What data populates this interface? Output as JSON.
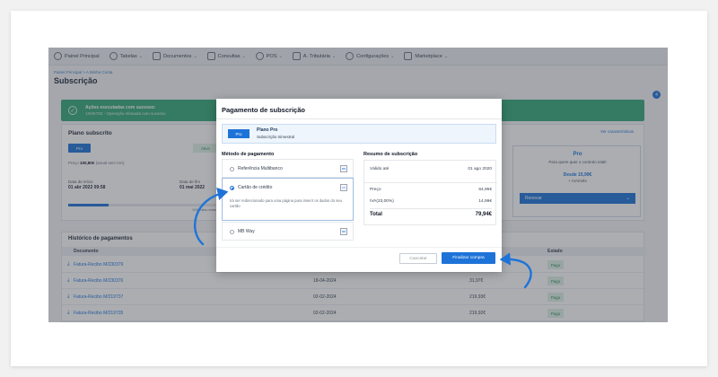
{
  "nav": {
    "items": [
      {
        "label": "Painel Principal",
        "icon": "dashboard-icon",
        "chevron": false
      },
      {
        "label": "Tabelas",
        "icon": "users-icon",
        "chevron": true
      },
      {
        "label": "Documentos",
        "icon": "document-icon",
        "chevron": true
      },
      {
        "label": "Consultas",
        "icon": "chart-icon",
        "chevron": true
      },
      {
        "label": "POS",
        "icon": "gear-icon",
        "chevron": true
      },
      {
        "label": "A. Tributária",
        "icon": "tax-icon",
        "chevron": true
      },
      {
        "label": "Configurações",
        "icon": "settings-icon",
        "chevron": true
      },
      {
        "label": "Marketplace",
        "icon": "grid-icon",
        "chevron": true
      }
    ]
  },
  "breadcrumb": "Painel Principal  >  A Minha Conta",
  "page_title": "Subscrição",
  "side_marker": "4",
  "success": {
    "title": "Ações executadas com sucesso:",
    "message": "1XNKT02 - Operação efetuada com sucesso"
  },
  "plan": {
    "title": "Plano subscrito",
    "plan_label": "Pro",
    "status": "Ativo",
    "price_label": "Preço",
    "price": "100,80€",
    "price_note": "(anual sem IVA)",
    "start_label": "Data de início",
    "start_value": "01 abr 2022 09:58",
    "end_label": "Data de fim",
    "end_value": "01 mai 2022",
    "progress": 0.25,
    "days_left": "1045 dias restantes",
    "compare_link": "Ver características",
    "offer": {
      "name": "Pro",
      "description": "Para quem quer o controlo total!",
      "price": "Desde 15,99€",
      "vat": "+ IVA/mês",
      "renew_button": "Renovar"
    }
  },
  "history": {
    "title": "Histórico de pagamentos",
    "columns": [
      "Documento",
      "Estado"
    ],
    "rows": [
      {
        "doc": "Fatura-Recibo M/230379",
        "date": "",
        "amount": "",
        "status": "Pago"
      },
      {
        "doc": "Fatura-Recibo M/230376",
        "date": "18-04-2024",
        "amount": "31,97€",
        "status": "Pago"
      },
      {
        "doc": "Fatura-Recibo M/219737",
        "date": "02-02-2024",
        "amount": "219,93€",
        "status": "Pago"
      },
      {
        "doc": "Fatura-Recibo M/219735",
        "date": "02-02-2024",
        "amount": "219,92€",
        "status": "Pago"
      }
    ]
  },
  "modal": {
    "title": "Pagamento de subscrição",
    "plan_pill": "Pro",
    "plan_name": "Plano Pro",
    "plan_sub": "Subscrição trimestral",
    "methods_title": "Método de pagamento",
    "methods": [
      {
        "label": "Referência Multibanco",
        "logo": "MB",
        "selected": false
      },
      {
        "label": "Cartão de crédito",
        "logo": "CC",
        "selected": true,
        "note": "Irá ser redirecionado para uma página para inserir os dados do seu cartão"
      },
      {
        "label": "MB Way",
        "logo": "MB",
        "selected": false
      }
    ],
    "summary_title": "Resumo de subscrição",
    "valid_label": "Válido até",
    "valid_value": "01 ago 2020",
    "price_label": "Preço",
    "price_value": "64,95€",
    "vat_label": "IVA(23,00%)",
    "vat_value": "14,99€",
    "total_label": "Total",
    "total_value": "79,94€",
    "cancel_button": "Cancelar",
    "finish_button": "Finalizar compra"
  },
  "colors": {
    "primary": "#1e73d8",
    "success": "#35a877",
    "annotation": "#1e73d8"
  }
}
